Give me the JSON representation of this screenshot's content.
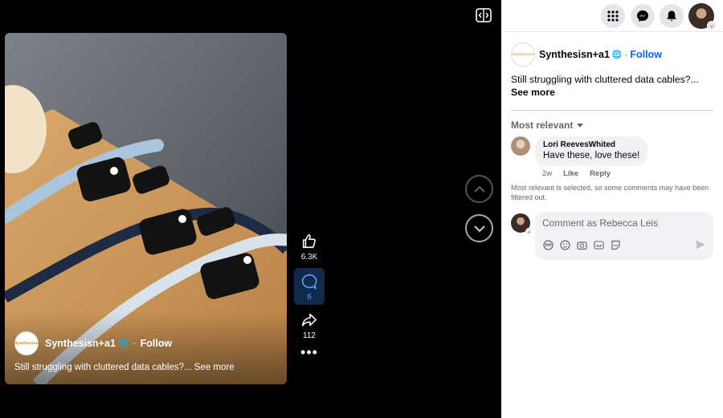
{
  "video": {
    "author": "Synthesisn+a1",
    "follow": "Follow",
    "caption": "Still struggling with cluttered data cables?...",
    "see_more": "See more",
    "brand_logo_text": "Synthesisn"
  },
  "actions": {
    "likes": "6.3K",
    "comments": "6",
    "shares": "112"
  },
  "post": {
    "author": "Synthesisn+a1",
    "separator": "·",
    "follow": "Follow",
    "text": "Still struggling with cluttered data cables?...",
    "see_more": "See more"
  },
  "comments": {
    "sort_label": "Most relevant",
    "items": [
      {
        "author": "Lori ReevesWhited",
        "text": "Have these, love these!",
        "age": "2w",
        "like": "Like",
        "reply": "Reply"
      }
    ],
    "filter_note": "Most relevant is selected, so some comments may have been filtered out.",
    "composer_placeholder": "Comment as Rebecca Leis"
  },
  "colors": {
    "accent": "#0866ff",
    "active_action_bg": "#13294b"
  },
  "icons": [
    "expand-icon",
    "like-icon",
    "comment-icon",
    "share-icon",
    "more-icon",
    "chevron-up-icon",
    "chevron-down-icon",
    "menu-grid-icon",
    "messenger-icon",
    "bell-icon",
    "globe-icon",
    "avatar-sticker-icon",
    "emoji-icon",
    "camera-icon",
    "gif-icon",
    "sticker-icon",
    "send-icon"
  ]
}
